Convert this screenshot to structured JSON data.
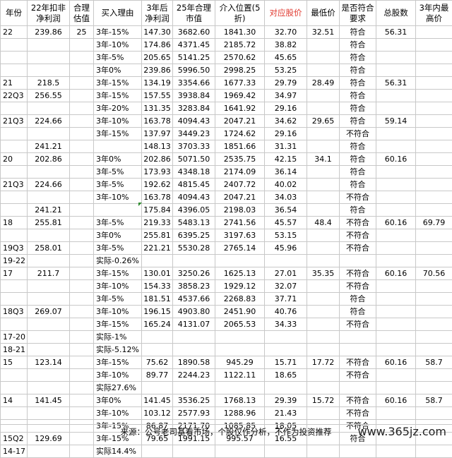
{
  "headers": [
    "年份",
    "22年扣非净利润",
    "合理估值",
    "买入理由",
    "3年后净利润",
    "25年合理市值",
    "介入位置(5折)",
    "对应股价",
    "最低价",
    "是否符合要求",
    "总股数",
    "3年内最高价"
  ],
  "rows": [
    [
      "22",
      "239.86",
      "25",
      "3年-15%",
      "147.30",
      "3682.60",
      "1841.30",
      "32.70",
      "32.51",
      "符合",
      "56.31",
      ""
    ],
    [
      "",
      "",
      "",
      "3年-10%",
      "174.86",
      "4371.45",
      "2185.72",
      "38.82",
      "",
      "符合",
      "",
      ""
    ],
    [
      "",
      "",
      "",
      "3年-5%",
      "205.65",
      "5141.25",
      "2570.62",
      "45.65",
      "",
      "符合",
      "",
      ""
    ],
    [
      "",
      "",
      "",
      "3年0%",
      "239.86",
      "5996.50",
      "2998.25",
      "53.25",
      "",
      "符合",
      "",
      ""
    ],
    [
      "21",
      "218.5",
      "",
      "3年-15%",
      "134.19",
      "3354.66",
      "1677.33",
      "29.79",
      "28.49",
      "符合",
      "56.31",
      ""
    ],
    [
      "22Q3",
      "256.55",
      "",
      "3年-15%",
      "157.55",
      "3938.84",
      "1969.42",
      "34.97",
      "",
      "符合",
      "",
      ""
    ],
    [
      "",
      "",
      "",
      "3年-20%",
      "131.35",
      "3283.84",
      "1641.92",
      "29.16",
      "",
      "符合",
      "",
      ""
    ],
    [
      "21Q3",
      "224.66",
      "",
      "3年-10%",
      "163.78",
      "4094.43",
      "2047.21",
      "34.62",
      "29.65",
      "符合",
      "59.14",
      ""
    ],
    [
      "",
      "",
      "",
      "3年-15%",
      "137.97",
      "3449.23",
      "1724.62",
      "29.16",
      "",
      "不符合",
      "",
      ""
    ],
    [
      "",
      "241.21",
      "",
      "",
      "148.13",
      "3703.33",
      "1851.66",
      "31.31",
      "",
      "符合",
      "",
      ""
    ],
    [
      "20",
      "202.86",
      "",
      "3年0%",
      "202.86",
      "5071.50",
      "2535.75",
      "42.15",
      "34.1",
      "符合",
      "60.16",
      ""
    ],
    [
      "",
      "",
      "",
      "3年-5%",
      "173.93",
      "4348.18",
      "2174.09",
      "36.14",
      "",
      "符合",
      "",
      ""
    ],
    [
      "21Q3",
      "224.66",
      "",
      "3年-5%",
      "192.62",
      "4815.45",
      "2407.72",
      "40.02",
      "",
      "符合",
      "",
      ""
    ],
    [
      "",
      "",
      "",
      "3年-10%",
      "163.78",
      "4094.43",
      "2047.21",
      "34.03",
      "",
      "不符合",
      "",
      ""
    ],
    [
      "",
      "241.21",
      "",
      "",
      "175.84",
      "4396.05",
      "2198.03",
      "36.54",
      "",
      "符合",
      "",
      ""
    ],
    [
      "18",
      "255.81",
      "",
      "3年-5%",
      "219.33",
      "5483.13",
      "2741.56",
      "45.57",
      "48.4",
      "不符合",
      "60.16",
      "69.79"
    ],
    [
      "",
      "",
      "",
      "3年0%",
      "255.81",
      "6395.25",
      "3197.63",
      "53.15",
      "",
      "不符合",
      "",
      ""
    ],
    [
      "19Q3",
      "258.01",
      "",
      "3年-5%",
      "221.21",
      "5530.28",
      "2765.14",
      "45.96",
      "",
      "不符合",
      "",
      ""
    ],
    [
      "19-22",
      "",
      "",
      "实际-0.26%",
      "",
      "",
      "",
      "",
      "",
      "",
      "",
      ""
    ],
    [
      "17",
      "211.7",
      "",
      "3年-15%",
      "130.01",
      "3250.26",
      "1625.13",
      "27.01",
      "35.35",
      "不符合",
      "60.16",
      "70.56"
    ],
    [
      "",
      "",
      "",
      "3年-10%",
      "154.33",
      "3858.23",
      "1929.12",
      "32.07",
      "",
      "不符合",
      "",
      ""
    ],
    [
      "",
      "",
      "",
      "3年-5%",
      "181.51",
      "4537.66",
      "2268.83",
      "37.71",
      "",
      "符合",
      "",
      ""
    ],
    [
      "18Q3",
      "269.07",
      "",
      "3年-10%",
      "196.15",
      "4903.80",
      "2451.90",
      "40.76",
      "",
      "符合",
      "",
      ""
    ],
    [
      "",
      "",
      "",
      "3年-15%",
      "165.24",
      "4131.07",
      "2065.53",
      "34.33",
      "",
      "不符合",
      "",
      ""
    ],
    [
      "17-20",
      "",
      "",
      "实际-1%",
      "",
      "",
      "",
      "",
      "",
      "",
      "",
      ""
    ],
    [
      "18-21",
      "",
      "",
      "实际-5.12%",
      "",
      "",
      "",
      "",
      "",
      "",
      "",
      ""
    ],
    [
      "15",
      "123.14",
      "",
      "3年-15%",
      "75.62",
      "1890.58",
      "945.29",
      "15.71",
      "17.72",
      "不符合",
      "60.16",
      "58.7"
    ],
    [
      "",
      "",
      "",
      "3年-10%",
      "89.77",
      "2244.23",
      "1122.11",
      "18.65",
      "",
      "不符合",
      "",
      ""
    ],
    [
      "",
      "",
      "",
      "实际27.6%",
      "",
      "",
      "",
      "",
      "",
      "",
      "",
      ""
    ],
    [
      "14",
      "141.45",
      "",
      "3年0%",
      "141.45",
      "3536.25",
      "1768.13",
      "29.39",
      "15.72",
      "不符合",
      "60.16",
      "58.7"
    ],
    [
      "",
      "",
      "",
      "3年-10%",
      "103.12",
      "2577.93",
      "1288.96",
      "21.43",
      "",
      "不符合",
      "",
      ""
    ],
    [
      "",
      "",
      "",
      "3年-15%",
      "86.87",
      "2171.70",
      "1085.85",
      "18.05",
      "",
      "不符合",
      "",
      ""
    ],
    [
      "15Q2",
      "129.69",
      "",
      "3年-15%",
      "79.65",
      "1991.15",
      "995.57",
      "16.55",
      "",
      "符合",
      "",
      ""
    ],
    [
      "14-17",
      "",
      "",
      "实际14.4%",
      "",
      "",
      "",
      "",
      "",
      "",
      "",
      ""
    ]
  ],
  "footer": {
    "source": "来源：公号老司基看市场，个股仅作分析，不作为投资推荐",
    "watermark": "www.365jz.com"
  },
  "colors": {
    "highlight_header": "#e0392f",
    "grid_line": "#c8c8c8"
  }
}
